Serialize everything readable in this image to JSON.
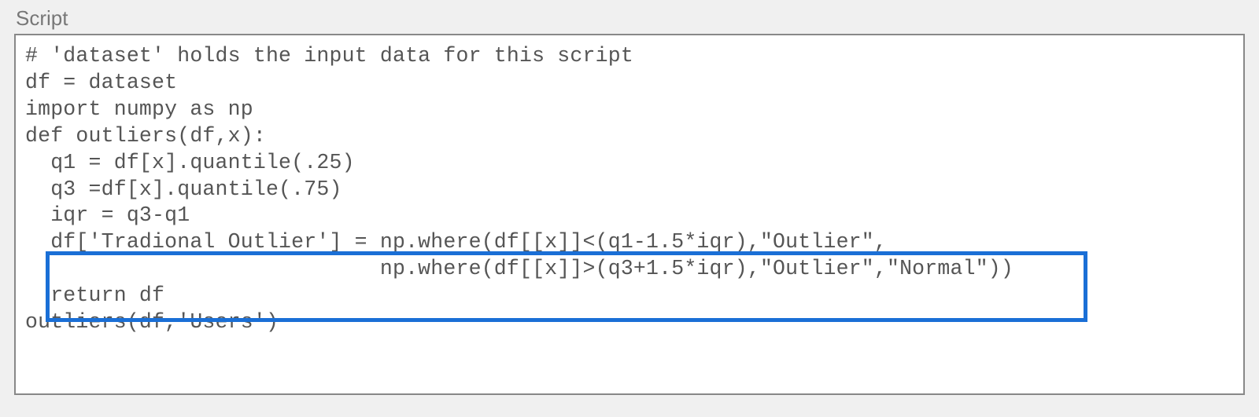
{
  "panel": {
    "label": "Script"
  },
  "code": {
    "lines": [
      "# 'dataset' holds the input data for this script",
      "df = dataset",
      "import numpy as np",
      "def outliers(df,x):",
      "  q1 = df[x].quantile(.25)",
      "  q3 =df[x].quantile(.75)",
      "  iqr = q3-q1",
      "  df['Tradional Outlier'] = np.where(df[[x]]<(q1-1.5*iqr),\"Outlier\",",
      "                            np.where(df[[x]]>(q3+1.5*iqr),\"Outlier\",\"Normal\"))",
      "  return df",
      "",
      "outliers(df,'Users')"
    ]
  },
  "highlight": {
    "start_line_index": 7,
    "end_line_index": 8
  }
}
